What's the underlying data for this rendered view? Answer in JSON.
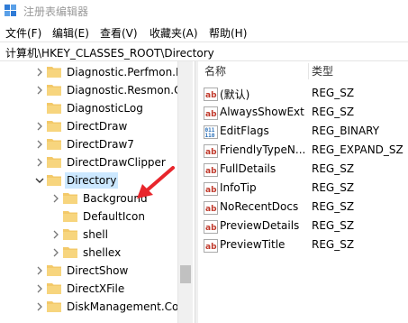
{
  "window": {
    "title": "注册表编辑器"
  },
  "menu": [
    {
      "label": "文件(F)"
    },
    {
      "label": "编辑(E)"
    },
    {
      "label": "查看(V)"
    },
    {
      "label": "收藏夹(A)"
    },
    {
      "label": "帮助(H)"
    }
  ],
  "address": {
    "path": "计算机\\HKEY_CLASSES_ROOT\\Directory"
  },
  "tree": {
    "items": [
      {
        "label": "Diagnostic.Perfmon.D"
      },
      {
        "label": "Diagnostic.Resmon.C"
      },
      {
        "label": "DiagnosticLog"
      },
      {
        "label": "DirectDraw"
      },
      {
        "label": "DirectDraw7"
      },
      {
        "label": "DirectDrawClipper"
      },
      {
        "label": "Directory",
        "selected": true
      },
      {
        "label": "Background"
      },
      {
        "label": "DefaultIcon"
      },
      {
        "label": "shell"
      },
      {
        "label": "shellex"
      },
      {
        "label": "DirectShow"
      },
      {
        "label": "DirectXFile"
      },
      {
        "label": "DiskManagement.Co"
      }
    ]
  },
  "values": {
    "columns": {
      "name": "名称",
      "type": "类型"
    },
    "rows": [
      {
        "name": "(默认)",
        "type": "REG_SZ",
        "icon": "string-value-icon"
      },
      {
        "name": "AlwaysShowExt",
        "type": "REG_SZ",
        "icon": "string-value-icon"
      },
      {
        "name": "EditFlags",
        "type": "REG_BINARY",
        "icon": "binary-value-icon"
      },
      {
        "name": "FriendlyTypeN...",
        "type": "REG_EXPAND_SZ",
        "icon": "string-value-icon"
      },
      {
        "name": "FullDetails",
        "type": "REG_SZ",
        "icon": "string-value-icon"
      },
      {
        "name": "InfoTip",
        "type": "REG_SZ",
        "icon": "string-value-icon"
      },
      {
        "name": "NoRecentDocs",
        "type": "REG_SZ",
        "icon": "string-value-icon"
      },
      {
        "name": "PreviewDetails",
        "type": "REG_SZ",
        "icon": "string-value-icon"
      },
      {
        "name": "PreviewTitle",
        "type": "REG_SZ",
        "icon": "string-value-icon"
      }
    ]
  },
  "colors": {
    "folder": "#f3c969",
    "selection": "#cce8ff",
    "annotation_arrow": "#e8262c",
    "value_icon_red": "#c0392b",
    "value_icon_blue": "#2a6fb8"
  }
}
